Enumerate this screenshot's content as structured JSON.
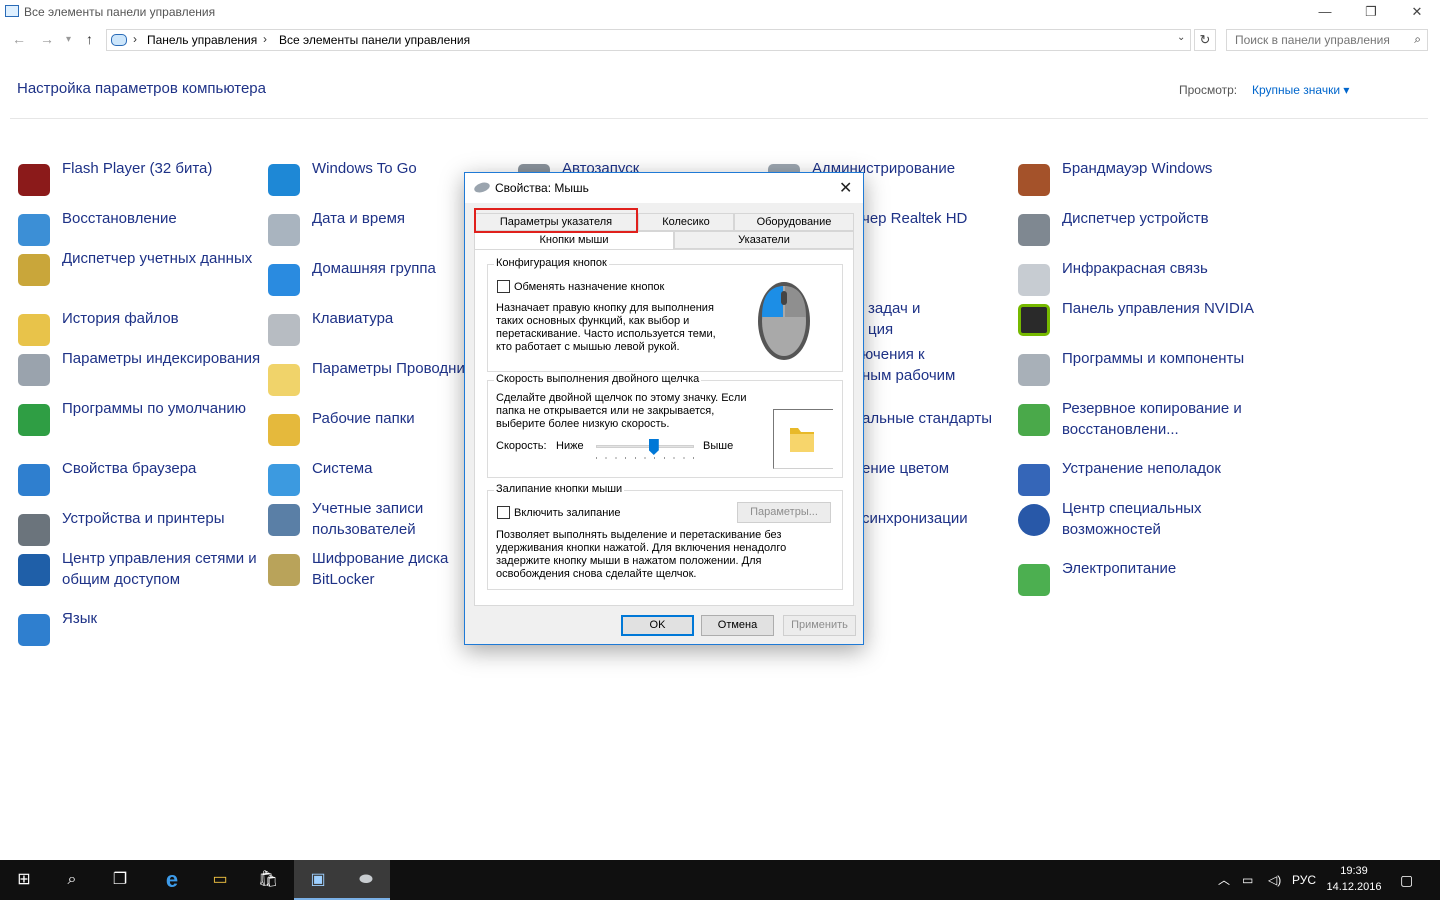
{
  "window": {
    "title": "Все элементы панели управления",
    "controls": [
      "—",
      "❐",
      "✕"
    ]
  },
  "nav": {
    "back_icon": "←",
    "forward_icon": "→",
    "recent_icon": "▾",
    "up_icon": "↑",
    "breadcrumb": [
      "Панель управления",
      "Все элементы панели управления"
    ],
    "sep": "›",
    "dropdown_icon": "⌄",
    "refresh_icon": "↻",
    "search_placeholder": "Поиск в панели управления",
    "search_icon": "⌕"
  },
  "header": {
    "title": "Настройка параметров компьютера",
    "view_label": "Просмотр:",
    "view_value": "Крупные значки ▾"
  },
  "items": {
    "col1": [
      "Flash Player (32 бита)",
      "Восстановление",
      "Диспетчер учетных данных",
      "История файлов",
      "Параметры индексирования",
      "Программы по умолчанию",
      "Свойства браузера",
      "Устройства и принтеры",
      "Центр управления сетями и общим доступом",
      "Язык"
    ],
    "col2": [
      "Windows To Go",
      "Дата и время",
      "Домашняя группа",
      "Клавиатура",
      "Параметры Проводника",
      "Рабочие папки",
      "Система",
      "Учетные записи пользователей",
      "Шифрование диска BitLocker"
    ],
    "col3": [
      "Автозапуск"
    ],
    "col4": [
      "Администрирование",
      "Диспетчер Realtek HD",
      "Панель задач и навигация",
      "Подключения к удаленным рабочим столам",
      "Региональные стандарты",
      "Управление цветом",
      "Центр синхронизации"
    ],
    "col4_visible": [
      "Администрирование",
      "чер Realtek HD",
      "задач и\nция",
      "ючения к\nным рабочим",
      "альные стандарты",
      "ение цветом",
      "синхронизации"
    ],
    "col5": [
      "Брандмауэр Windows",
      "Диспетчер устройств",
      "Инфракрасная связь",
      "Панель управления NVIDIA",
      "Программы и компоненты",
      "Резервное копирование и восстановлени...",
      "Устранение неполадок",
      "Центр специальных возможностей",
      "Электропитание"
    ]
  },
  "dialog": {
    "title": "Свойства: Мышь",
    "close": "✕",
    "tabs_row1": [
      "Параметры указателя",
      "Колесико",
      "Оборудование"
    ],
    "tabs_row2": [
      "Кнопки мыши",
      "Указатели"
    ],
    "group1": {
      "title": "Конфигурация кнопок",
      "checkbox": "Обменять назначение кнопок",
      "desc": "Назначает правую кнопку для выполнения таких основных функций, как выбор и перетаскивание. Часто используется теми, кто работает с мышью левой рукой."
    },
    "group2": {
      "title": "Скорость выполнения двойного щелчка",
      "desc": "Сделайте двойной щелчок по этому значку. Если папка не открывается или не закрывается, выберите более низкую скорость.",
      "speed_label": "Скорость:",
      "low": "Ниже",
      "high": "Выше",
      "speed_level": 0.6
    },
    "group3": {
      "title": "Залипание кнопки мыши",
      "checkbox": "Включить залипание",
      "params_button": "Параметры...",
      "desc": "Позволяет выполнять выделение и перетаскивание без удерживания кнопки нажатой. Для включения ненадолго задержите кнопку мыши в нажатом положении. Для освобождения снова сделайте щелчок."
    },
    "buttons": {
      "ok": "OK",
      "cancel": "Отмена",
      "apply": "Применить"
    }
  },
  "taskbar": {
    "start_icon": "⊞",
    "search_icon": "⌕",
    "taskview_icon": "❐",
    "edge_icon": "e",
    "explorer_icon": "▭",
    "store_icon": "🛍",
    "tray_arrow": "︿",
    "lang": "РУС",
    "time": "19:39",
    "date": "14.12.2016",
    "notify_icon": "▢"
  },
  "colors": {
    "link": "#1e3287",
    "accent": "#0078d7",
    "highlight": "#e0201c"
  }
}
